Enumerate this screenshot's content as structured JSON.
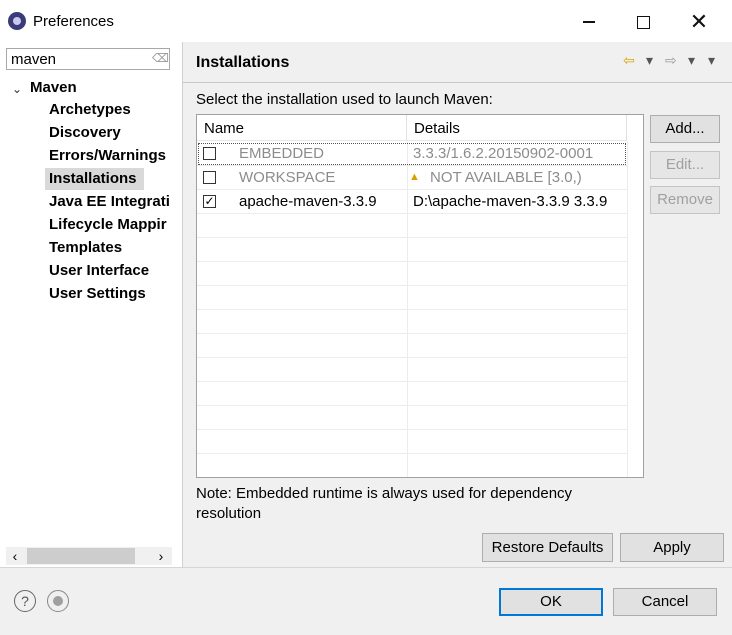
{
  "window": {
    "title": "Preferences"
  },
  "filter": {
    "value": "maven"
  },
  "tree": {
    "root": "Maven",
    "children": [
      {
        "label": "Archetypes"
      },
      {
        "label": "Discovery"
      },
      {
        "label": "Errors/Warnings"
      },
      {
        "label": "Installations",
        "selected": true
      },
      {
        "label": "Java EE Integrati"
      },
      {
        "label": "Lifecycle Mappir"
      },
      {
        "label": "Templates"
      },
      {
        "label": "User Interface"
      },
      {
        "label": "User Settings"
      }
    ]
  },
  "page": {
    "title": "Installations",
    "instruction": "Select the installation used to launch Maven:",
    "note": "Note: Embedded runtime is always used for dependency resolution"
  },
  "table": {
    "columns": [
      "Name",
      "Details"
    ],
    "rows": [
      {
        "name": "EMBEDDED",
        "details": "3.3.3/1.6.2.20150902-0001",
        "checked": false,
        "enabled": false
      },
      {
        "name": "WORKSPACE",
        "details": "NOT AVAILABLE [3.0,)",
        "checked": false,
        "enabled": false,
        "warning": true
      },
      {
        "name": "apache-maven-3.3.9",
        "details": "D:\\apache-maven-3.3.9 3.3.9",
        "checked": true,
        "enabled": true
      }
    ]
  },
  "buttons": {
    "add": "Add...",
    "edit": "Edit...",
    "remove": "Remove",
    "restore_defaults": "Restore Defaults",
    "apply": "Apply",
    "ok": "OK",
    "cancel": "Cancel"
  },
  "icons": {
    "app": "eclipse-icon",
    "back": "back-arrow-icon",
    "forward": "forward-arrow-icon",
    "help": "help-icon",
    "import": "import-preferences-icon",
    "warning": "warning-icon"
  },
  "colors": {
    "accent": "#0078d7",
    "selection": "#d9d9d9",
    "warning": "#d8a000"
  }
}
